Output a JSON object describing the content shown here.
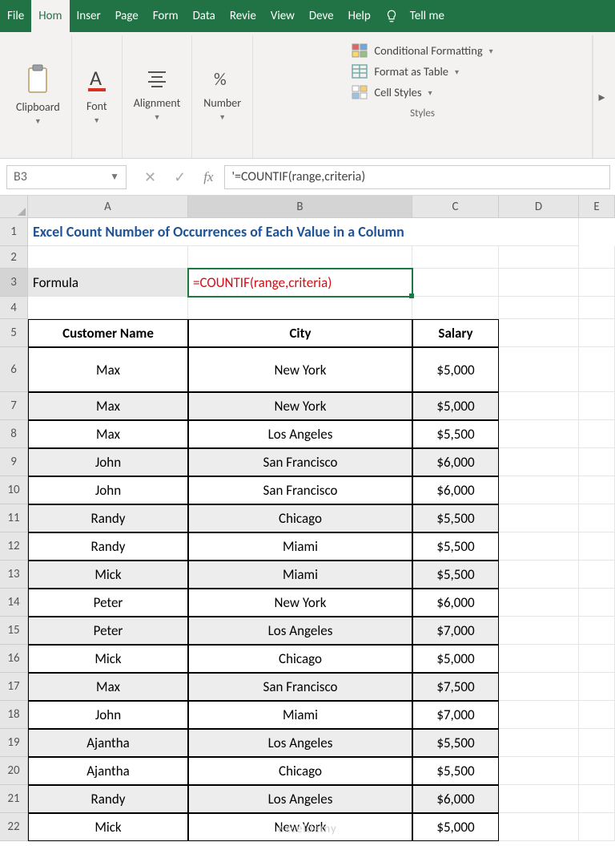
{
  "ribbon": {
    "tabs": [
      "File",
      "Hom",
      "Inser",
      "Page",
      "Form",
      "Data",
      "Revie",
      "View",
      "Deve",
      "Help"
    ],
    "active_tab_index": 1,
    "tellme": "Tell me",
    "groups": {
      "clipboard": "Clipboard",
      "font": "Font",
      "alignment": "Alignment",
      "number": "Number",
      "styles": "Styles"
    },
    "styles_items": {
      "cond": "Conditional Formatting",
      "table": "Format as Table",
      "cell": "Cell Styles"
    }
  },
  "name_box": "B3",
  "formula_bar": "'=COUNTIF(range,criteria)",
  "columns": [
    "A",
    "B",
    "C",
    "D",
    "E"
  ],
  "row_numbers": [
    1,
    2,
    3,
    4,
    5,
    6,
    7,
    8,
    9,
    10,
    11,
    12,
    13,
    14,
    15,
    16,
    17,
    18,
    19,
    20,
    21,
    22
  ],
  "title_text": "Excel Count Number of Occurrences of Each Value in a Column",
  "formula_row": {
    "label": "Formula",
    "value": "=COUNTIF(range,criteria)"
  },
  "table": {
    "headers": [
      "Customer Name",
      "City",
      "Salary"
    ],
    "rows": [
      [
        "Max",
        "New York",
        "$5,000"
      ],
      [
        "Max",
        "New York",
        "$5,000"
      ],
      [
        "Max",
        "Los Angeles",
        "$5,500"
      ],
      [
        "John",
        "San Francisco",
        "$6,000"
      ],
      [
        "John",
        "San Francisco",
        "$6,000"
      ],
      [
        "Randy",
        "Chicago",
        "$5,500"
      ],
      [
        "Randy",
        "Miami",
        "$5,500"
      ],
      [
        "Mick",
        "Miami",
        "$5,500"
      ],
      [
        "Peter",
        "New York",
        "$6,000"
      ],
      [
        "Peter",
        "Los Angeles",
        "$7,000"
      ],
      [
        "Mick",
        "Chicago",
        "$5,000"
      ],
      [
        "Max",
        "San Francisco",
        "$7,500"
      ],
      [
        "John",
        "Miami",
        "$7,000"
      ],
      [
        "Ajantha",
        "Los Angeles",
        "$5,500"
      ],
      [
        "Ajantha",
        "Chicago",
        "$5,500"
      ],
      [
        "Randy",
        "Los Angeles",
        "$6,000"
      ],
      [
        "Mick",
        "New York",
        "$5,000"
      ]
    ]
  },
  "watermark": "exceldemy"
}
